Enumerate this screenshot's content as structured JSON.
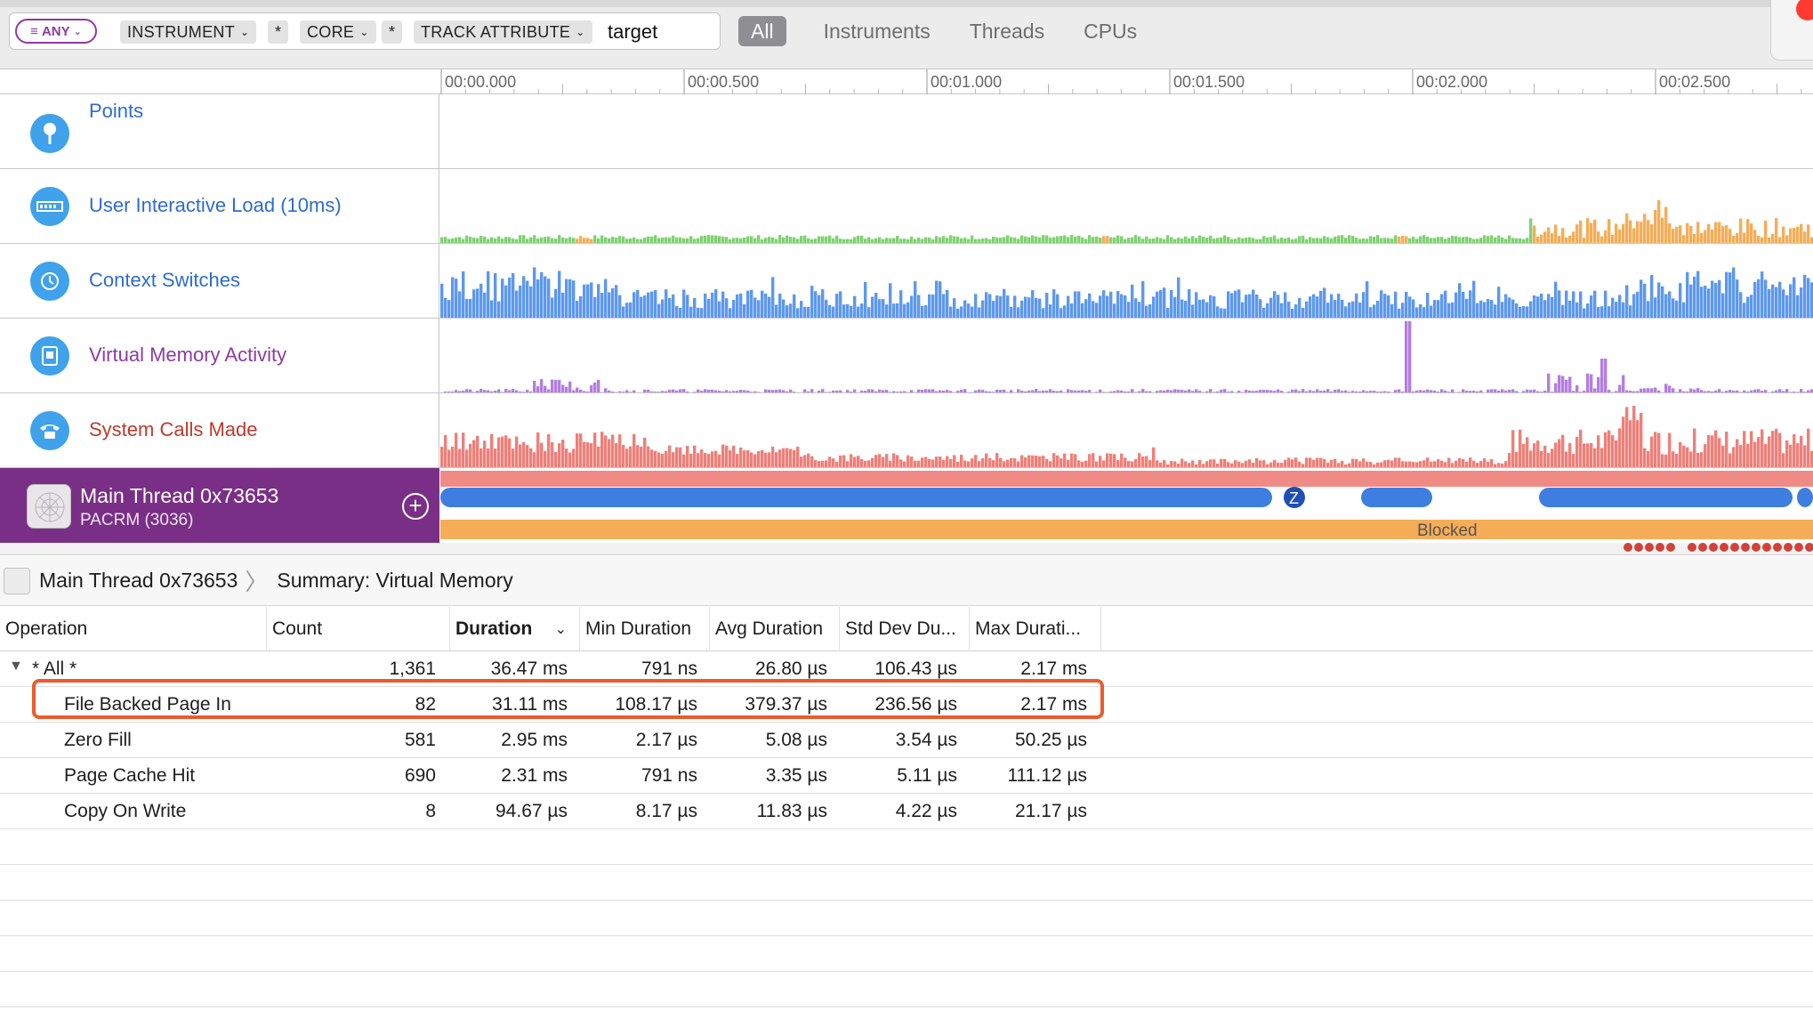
{
  "filter": {
    "any_label": "ANY",
    "tokens": [
      "INSTRUMENT",
      "*",
      "CORE",
      "*",
      "TRACK ATTRIBUTE"
    ],
    "search_text": "target"
  },
  "tabs": [
    {
      "label": "All",
      "active": true
    },
    {
      "label": "Instruments",
      "active": false
    },
    {
      "label": "Threads",
      "active": false
    },
    {
      "label": "CPUs",
      "active": false
    }
  ],
  "ruler": {
    "ticks": [
      "00:00.000",
      "00:00.500",
      "00:01.000",
      "00:01.500",
      "00:02.000",
      "00:02.500"
    ]
  },
  "tracks": [
    {
      "name": "Points",
      "color": "#2f6bd0",
      "icon": "pin-icon"
    },
    {
      "name": "User Interactive Load (10ms)",
      "color": "#2f6bd0",
      "icon": "load-icon"
    },
    {
      "name": "Context Switches",
      "color": "#2f6bd0",
      "icon": "context-switch-icon"
    },
    {
      "name": "Virtual Memory Activity",
      "color": "#8e3aa3",
      "icon": "memory-icon"
    },
    {
      "name": "System Calls Made",
      "color": "#c0392b",
      "icon": "phone-icon"
    }
  ],
  "main_thread": {
    "name": "Main Thread  0x73653",
    "process": "PACRM (3036)",
    "sleep_badge": "Z",
    "blocked_label": "Blocked"
  },
  "breadcrumb": {
    "thread": "Main Thread  0x73653",
    "summary": "Summary: Virtual Memory"
  },
  "table": {
    "columns": [
      "Operation",
      "Count",
      "Duration",
      "Min Duration",
      "Avg Duration",
      "Std Dev Du...",
      "Max Durati..."
    ],
    "sorted_column": "Duration",
    "rows": [
      {
        "op": "* All *",
        "count": "1,361",
        "duration": "36.47 ms",
        "min": "791 ns",
        "avg": "26.80 µs",
        "std": "106.43 µs",
        "max": "2.17 ms",
        "disclosure": "▼",
        "highlight": false
      },
      {
        "op": "File Backed Page In",
        "count": "82",
        "duration": "31.11 ms",
        "min": "108.17 µs",
        "avg": "379.37 µs",
        "std": "236.56 µs",
        "max": "2.17 ms",
        "highlight": true
      },
      {
        "op": "Zero Fill",
        "count": "581",
        "duration": "2.95 ms",
        "min": "2.17 µs",
        "avg": "5.08 µs",
        "std": "3.54 µs",
        "max": "50.25 µs",
        "highlight": false
      },
      {
        "op": "Page Cache Hit",
        "count": "690",
        "duration": "2.31 ms",
        "min": "791 ns",
        "avg": "3.35 µs",
        "std": "5.11 µs",
        "max": "111.12 µs",
        "highlight": false
      },
      {
        "op": "Copy On Write",
        "count": "8",
        "duration": "94.67 µs",
        "min": "8.17 µs",
        "avg": "11.83 µs",
        "std": "4.22 µs",
        "max": "21.17 µs",
        "highlight": false
      }
    ]
  },
  "colors": {
    "accent_purple": "#7a2f86",
    "load_green": "#7ed36f",
    "load_orange": "#f5ad58",
    "context_blue": "#5d98ee",
    "vm_purple": "#b47de0",
    "syscall_red": "#ef7f79",
    "highlight_orange": "#ec5a2e"
  }
}
